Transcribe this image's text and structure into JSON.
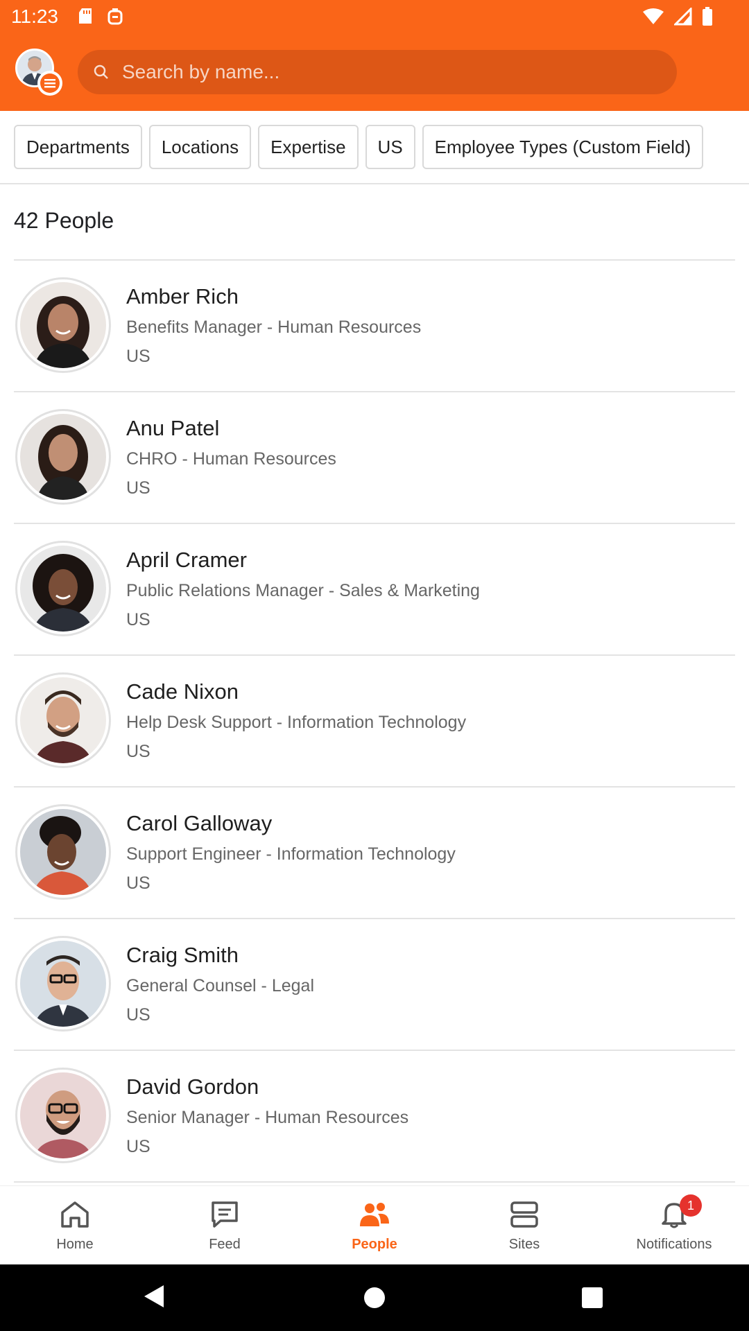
{
  "status_bar": {
    "time": "11:23"
  },
  "search": {
    "placeholder": "Search by name..."
  },
  "filters": [
    "Departments",
    "Locations",
    "Expertise",
    "US",
    "Employee Types (Custom Field)"
  ],
  "people_count": "42 People",
  "people": [
    {
      "name": "Amber Rich",
      "title": "Benefits Manager - Human Resources",
      "location": "US"
    },
    {
      "name": "Anu Patel",
      "title": "CHRO - Human Resources",
      "location": "US"
    },
    {
      "name": "April Cramer",
      "title": "Public Relations Manager - Sales & Marketing",
      "location": "US"
    },
    {
      "name": "Cade Nixon",
      "title": "Help Desk Support - Information Technology",
      "location": "US"
    },
    {
      "name": "Carol Galloway",
      "title": "Support Engineer - Information Technology",
      "location": "US"
    },
    {
      "name": "Craig Smith",
      "title": "General Counsel - Legal",
      "location": "US"
    },
    {
      "name": "David Gordon",
      "title": "Senior Manager - Human Resources",
      "location": "US"
    }
  ],
  "nav": [
    {
      "label": "Home",
      "icon": "home-icon"
    },
    {
      "label": "Feed",
      "icon": "feed-icon"
    },
    {
      "label": "People",
      "icon": "people-icon",
      "active": true
    },
    {
      "label": "Sites",
      "icon": "sites-icon"
    },
    {
      "label": "Notifications",
      "icon": "bell-icon",
      "badge": "1"
    }
  ],
  "colors": {
    "brand": "#fa6518",
    "search_bg": "#dd5716",
    "badge": "#e5322d"
  }
}
